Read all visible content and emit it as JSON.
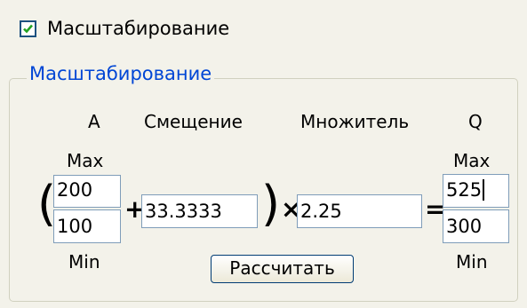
{
  "checkbox": {
    "label": "Масштабирование",
    "checked": true
  },
  "group": {
    "title": "Масштабирование"
  },
  "columns": {
    "a": "A",
    "offset": "Смещение",
    "multiplier": "Множитель",
    "q": "Q"
  },
  "labels": {
    "max_left": "Max",
    "min_left": "Min",
    "max_right": "Max",
    "min_right": "Min"
  },
  "fields": {
    "a_max": "200",
    "a_min": "100",
    "offset": "33.3333",
    "multiplier": "2.25",
    "q_max": "525",
    "q_min": "300"
  },
  "operators": {
    "open_paren": "(",
    "plus": "+",
    "close_paren": ")",
    "times": "×",
    "equals": "="
  },
  "button": {
    "calculate": "Рассчитать"
  },
  "colors": {
    "panel_bg": "#f3f2ea",
    "legend_text": "#0046d5",
    "field_border": "#7f9db9",
    "checkbox_border": "#1c5180",
    "check_mark": "#21a121"
  }
}
